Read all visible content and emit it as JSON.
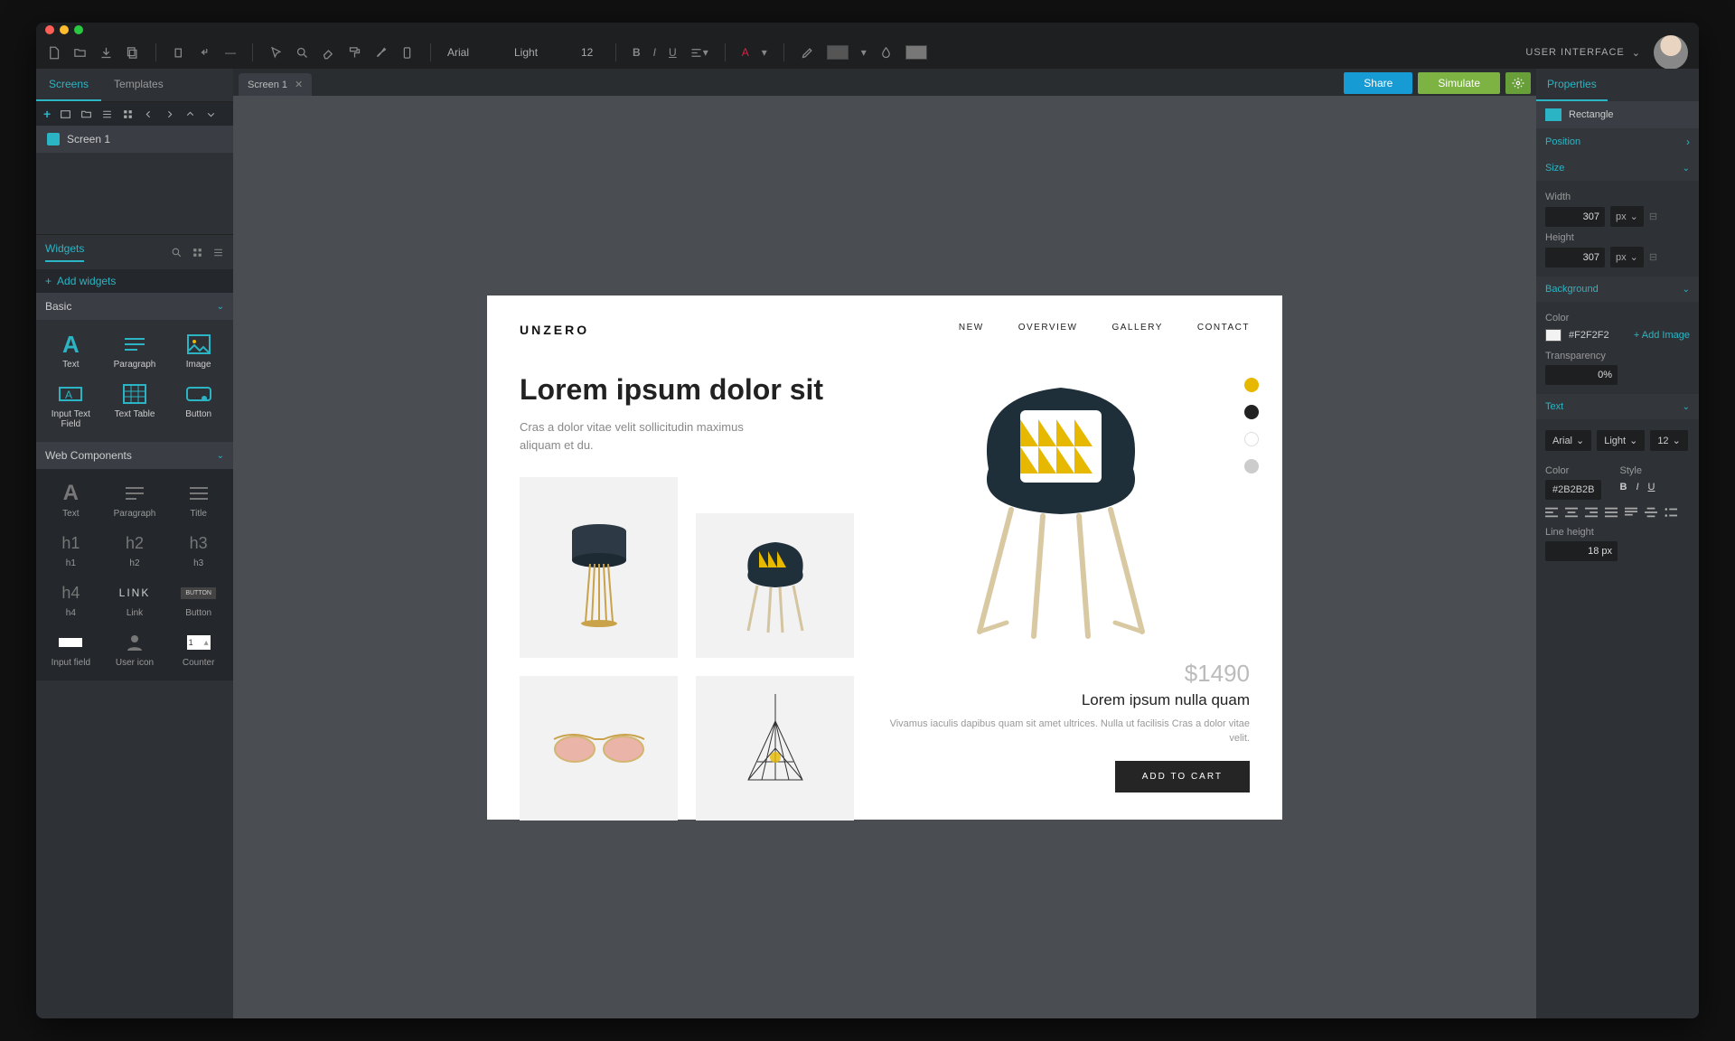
{
  "toolbar": {
    "font": "Arial",
    "weight": "Light",
    "size": "12",
    "mode_label": "USER INTERFACE"
  },
  "left_panel": {
    "tabs": [
      "Screens",
      "Templates"
    ],
    "screens": [
      {
        "label": "Screen 1"
      }
    ],
    "widgets_title": "Widgets",
    "add_widgets_label": "Add widgets",
    "categories": {
      "basic": {
        "title": "Basic",
        "items": [
          "Text",
          "Paragraph",
          "Image",
          "Input Text Field",
          "Text Table",
          "Button"
        ]
      },
      "web": {
        "title": "Web Components",
        "items": [
          "Text",
          "Paragraph",
          "Title",
          "h1",
          "h2",
          "h3",
          "h4",
          "Link",
          "Button",
          "Input field",
          "User icon",
          "Counter"
        ]
      }
    }
  },
  "doc_tabs": [
    {
      "label": "Screen 1"
    }
  ],
  "actions": {
    "share": "Share",
    "simulate": "Simulate"
  },
  "canvas": {
    "brand": "UNZERO",
    "nav": [
      "NEW",
      "OVERVIEW",
      "GALLERY",
      "CONTACT"
    ],
    "headline": "Lorem ipsum dolor sit",
    "subtext": "Cras a dolor vitae velit sollicitudin maximus aliquam et du.",
    "price": "$1490",
    "prod_title": "Lorem ipsum nulla quam",
    "prod_desc": "Vivamus iaculis dapibus quam sit amet ultrices. Nulla ut facilisis Cras a dolor vitae velit.",
    "add_to_cart": "ADD TO CART",
    "swatch_colors": [
      "#e6b800",
      "#222222",
      "#ffffff",
      "#cccccc"
    ]
  },
  "right_panel": {
    "tab": "Properties",
    "selection": "Rectangle",
    "position_label": "Position",
    "size_label": "Size",
    "width_label": "Width",
    "width_value": "307",
    "width_unit": "px",
    "height_label": "Height",
    "height_value": "307",
    "height_unit": "px",
    "background_label": "Background",
    "color_label": "Color",
    "bg_color_value": "#F2F2F2",
    "add_image_label": "+ Add Image",
    "transparency_label": "Transparency",
    "transparency_value": "0%",
    "text_label": "Text",
    "text_font": "Arial",
    "text_weight": "Light",
    "text_size": "12",
    "text_color_label": "Color",
    "text_color_value": "#2B2B2B",
    "style_label": "Style",
    "line_height_label": "Line height",
    "line_height_value": "18 px"
  }
}
